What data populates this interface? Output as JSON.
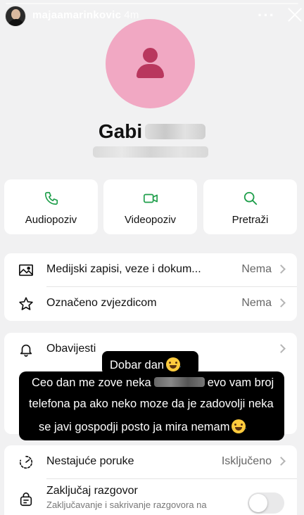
{
  "story": {
    "username": "majaamarinkovic",
    "time": "4m",
    "more_icon": "more-dots-icon",
    "close_icon": "close-icon"
  },
  "contact": {
    "name": "Gabi"
  },
  "actions": [
    {
      "label": "Audiopoziv",
      "icon": "phone-icon"
    },
    {
      "label": "Videopoziv",
      "icon": "video-camera-icon"
    },
    {
      "label": "Pretraži",
      "icon": "search-icon"
    }
  ],
  "media_card": {
    "rows": [
      {
        "label": "Medijski zapisi, veze i dokum...",
        "value": "Nema",
        "icon": "image-icon"
      },
      {
        "label": "Označeno zvjezdicom",
        "value": "Nema",
        "icon": "star-icon"
      }
    ]
  },
  "notifications": {
    "label": "Obavijesti",
    "icon": "bell-icon"
  },
  "privacy_card": {
    "disappearing_label": "Nestajuće poruke",
    "disappearing_value": "Isključeno",
    "disappearing_icon": "timer-icon",
    "lock_label": "Zaključaj razgovor",
    "lock_sub": "Zaključavanje i sakrivanje razgovora na",
    "lock_icon": "chat-lock-icon",
    "lock_enabled": false
  },
  "caption": {
    "line1": "Dobar dan",
    "line2_part1": "Ceo dan me zove neka",
    "line2_part2": "evo vam broj",
    "line3": "telefona pa ako neko moze da je zadovolji neka",
    "line4": "se javi gospodji posto ja mira nemam"
  },
  "colors": {
    "accent_green": "#1e9e4a",
    "avatar_pink": "#f1a8c3",
    "avatar_icon": "#b9375e"
  }
}
